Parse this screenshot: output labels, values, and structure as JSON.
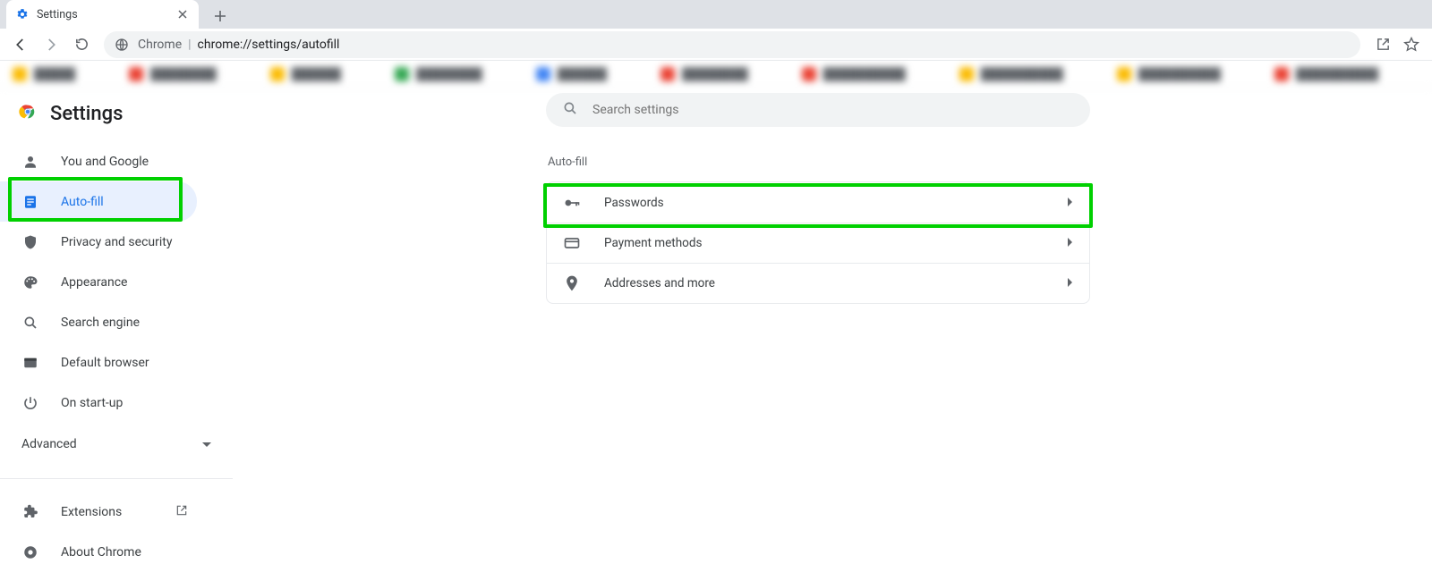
{
  "tab": {
    "title": "Settings"
  },
  "omnibox": {
    "origin": "Chrome",
    "url": "chrome://settings/autofill"
  },
  "sidebar": {
    "title": "Settings",
    "items": [
      {
        "label": "You and Google"
      },
      {
        "label": "Auto-fill"
      },
      {
        "label": "Privacy and security"
      },
      {
        "label": "Appearance"
      },
      {
        "label": "Search engine"
      },
      {
        "label": "Default browser"
      },
      {
        "label": "On start-up"
      }
    ],
    "advanced": "Advanced",
    "extensions": "Extensions",
    "about": "About Chrome"
  },
  "search": {
    "placeholder": "Search settings"
  },
  "section": {
    "title": "Auto-fill"
  },
  "rows": [
    {
      "label": "Passwords"
    },
    {
      "label": "Payment methods"
    },
    {
      "label": "Addresses and more"
    }
  ]
}
